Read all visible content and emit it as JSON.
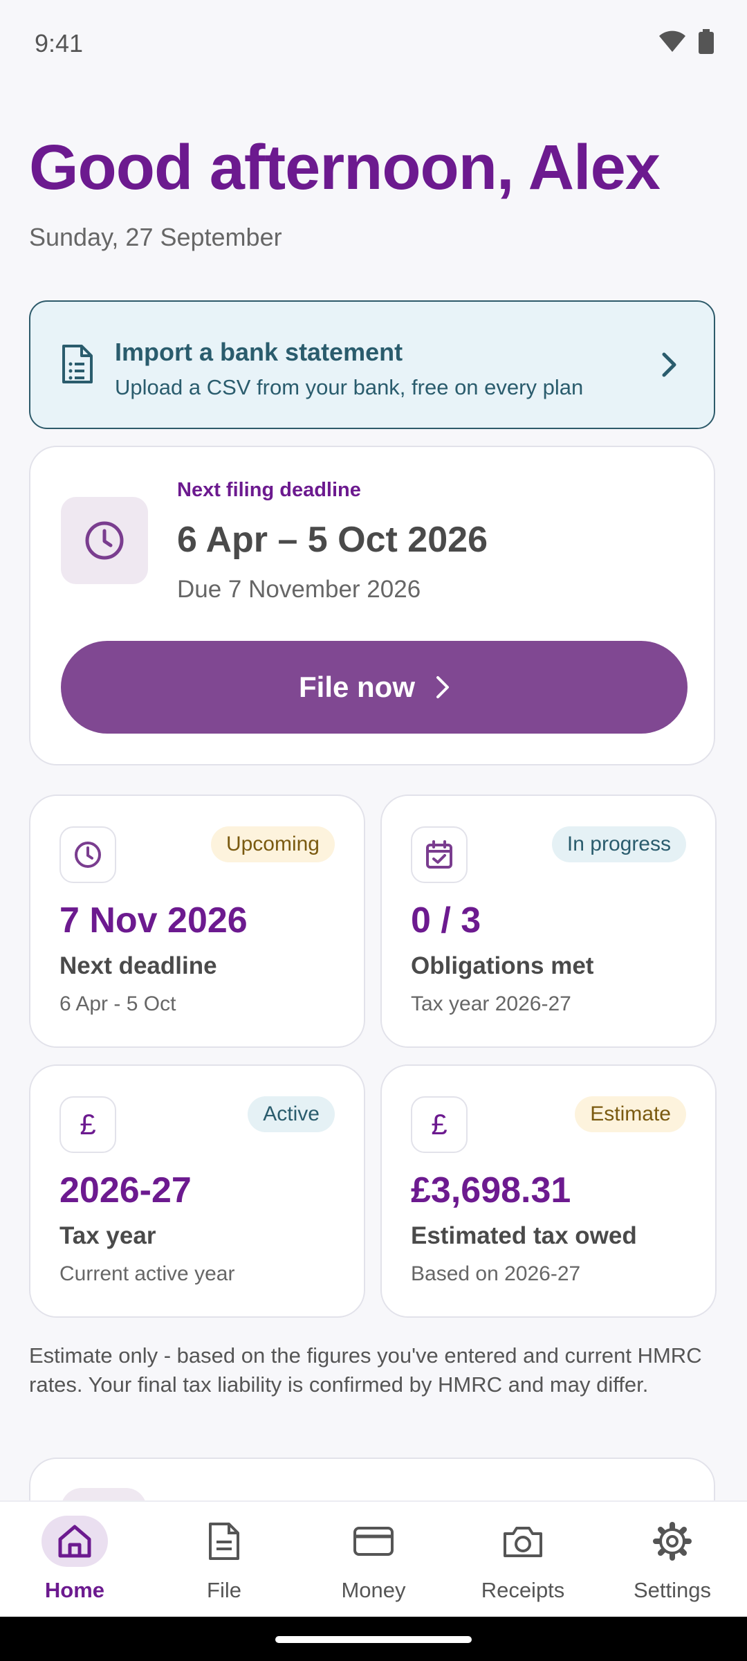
{
  "status": {
    "time": "9:41"
  },
  "greeting": "Good afternoon, Alex",
  "date": "Sunday, 27 September",
  "import_card": {
    "title": "Import a bank statement",
    "subtitle": "Upload a CSV from your bank, free on every plan"
  },
  "deadline_card": {
    "label": "Next filing deadline",
    "period": "6 Apr – 5 Oct 2026",
    "due": "Due 7 November 2026",
    "button_label": "File now"
  },
  "tiles": [
    {
      "icon": "clock-icon",
      "badge": "Upcoming",
      "value": "7 Nov 2026",
      "label": "Next deadline",
      "sub": "6 Apr - 5 Oct"
    },
    {
      "icon": "calendar-check-icon",
      "badge": "In progress",
      "value": "0 / 3",
      "label": "Obligations met",
      "sub": "Tax year 2026-27"
    },
    {
      "icon": "pound-icon",
      "icon_glyph": "£",
      "badge": "Active",
      "value": "2026-27",
      "label": "Tax year",
      "sub": "Current active year"
    },
    {
      "icon": "pound-icon",
      "icon_glyph": "£",
      "badge": "Estimate",
      "value": "£3,698.31",
      "label": "Estimated tax owed",
      "sub": "Based on 2026-27"
    }
  ],
  "disclaimer": "Estimate only - based on the figures you've entered and current HMRC rates. Your final tax liability is confirmed by HMRC and may differ.",
  "nav": [
    {
      "label": "Home",
      "icon": "home-icon",
      "active": true
    },
    {
      "label": "File",
      "icon": "document-icon",
      "active": false
    },
    {
      "label": "Money",
      "icon": "card-icon",
      "active": false
    },
    {
      "label": "Receipts",
      "icon": "camera-icon",
      "active": false
    },
    {
      "label": "Settings",
      "icon": "gear-icon",
      "active": false
    }
  ],
  "colors": {
    "brand": "#6c1a8f",
    "button": "#804892",
    "import_bg": "#e8f3f8",
    "import_border": "#2d5a6a",
    "badge_yellow": "#fdf3dd",
    "badge_blue": "#e5f1f5"
  }
}
